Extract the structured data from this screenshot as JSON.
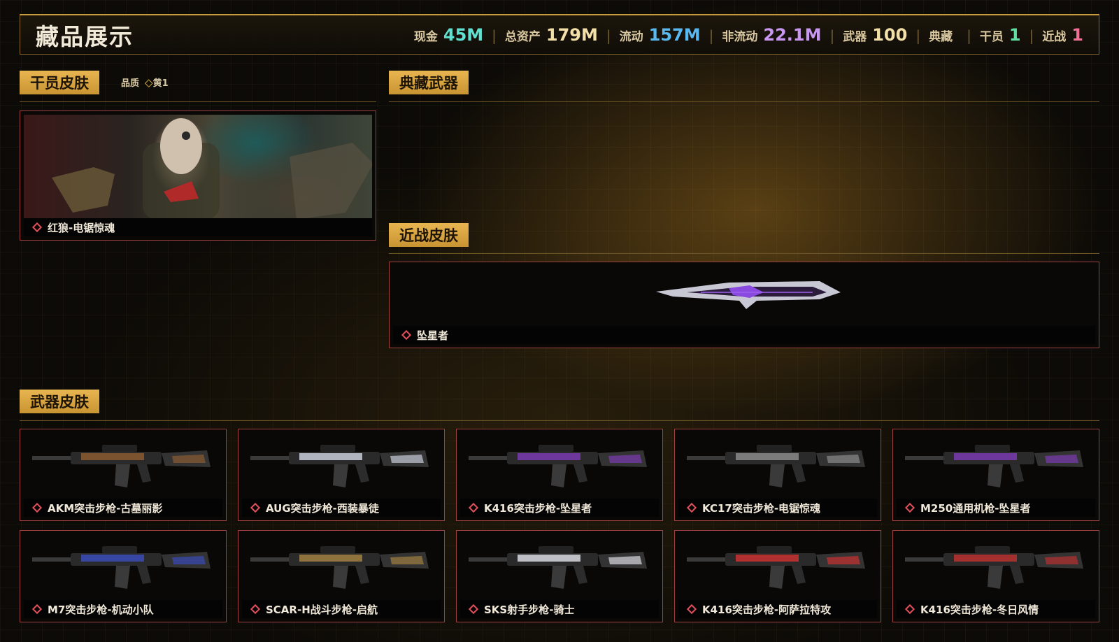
{
  "header": {
    "title": "藏品展示",
    "stats": [
      {
        "label": "现金",
        "value": "45M",
        "color": "#5fe0d0"
      },
      {
        "label": "总资产",
        "value": "179M",
        "color": "#f3e0a8"
      },
      {
        "label": "流动",
        "value": "157M",
        "color": "#5ab8f0"
      },
      {
        "label": "非流动",
        "value": "22.1M",
        "color": "#c898f0"
      },
      {
        "label": "武器",
        "value": "100",
        "color": "#f3e0a8"
      },
      {
        "label": "典藏",
        "value": "",
        "color": "#f3e0a8"
      },
      {
        "label": "干员",
        "value": "1",
        "color": "#5fe0a0"
      },
      {
        "label": "近战",
        "value": "1",
        "color": "#f07098"
      }
    ]
  },
  "sections": {
    "operator": "干员皮肤",
    "operator_quality_label": "品质",
    "operator_quality_value": "黄1",
    "collection": "典藏武器",
    "melee": "近战皮肤",
    "weapon": "武器皮肤"
  },
  "operator_card": {
    "name": "红狼-电锯惊魂"
  },
  "melee_card": {
    "name": "坠星者"
  },
  "weapon_cards": [
    {
      "name": "AKM突击步枪-古墓丽影",
      "tone": "#8a5a30"
    },
    {
      "name": "AUG突击步枪-西装暴徒",
      "tone": "#c8ccd8"
    },
    {
      "name": "K416突击步枪-坠星者",
      "tone": "#7a3ab0"
    },
    {
      "name": "KC17突击步枪-电锯惊魂",
      "tone": "#8a8a8a"
    },
    {
      "name": "M250通用机枪-坠星者",
      "tone": "#7a3ab0"
    },
    {
      "name": "M7突击步枪-机动小队",
      "tone": "#3a4ab8"
    },
    {
      "name": "SCAR-H战斗步枪-启航",
      "tone": "#a08040"
    },
    {
      "name": "SKS射手步枪-骑士",
      "tone": "#d8d8e0"
    },
    {
      "name": "K416突击步枪-阿萨拉特攻",
      "tone": "#c83030"
    },
    {
      "name": "K416突击步枪-冬日风情",
      "tone": "#b83030"
    }
  ]
}
